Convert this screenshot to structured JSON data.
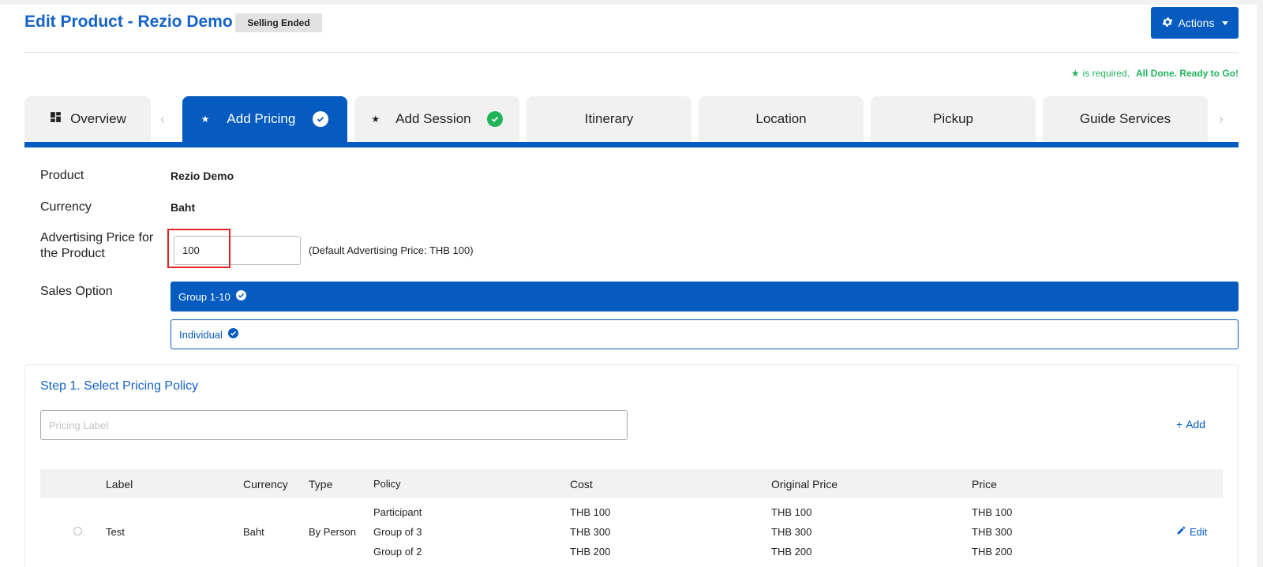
{
  "header": {
    "title": "Edit Product  - Rezio Demo",
    "status_badge": "Selling Ended",
    "actions_label": "Actions"
  },
  "required_note": {
    "star": "★",
    "text": "is required,",
    "done": "All Done. Ready to Go!"
  },
  "tabs": [
    {
      "label": "Overview",
      "icon": "dashboard-icon"
    },
    {
      "label": "Add Pricing",
      "required": true,
      "complete": true,
      "active": true
    },
    {
      "label": "Add Session",
      "required": true,
      "complete": true
    },
    {
      "label": "Itinerary"
    },
    {
      "label": "Location"
    },
    {
      "label": "Pickup"
    },
    {
      "label": "Guide Services"
    }
  ],
  "form": {
    "product_label": "Product",
    "product_value": "Rezio Demo",
    "currency_label": "Currency",
    "currency_value": "Baht",
    "adv_price_label_line1": "Advertising Price for",
    "adv_price_label_line2": "the Product",
    "adv_price_value": "100",
    "adv_price_note": "(Default Advertising Price: THB 100)",
    "sales_option_label": "Sales Option",
    "sales_options": [
      {
        "label": "Group 1-10",
        "selected": true
      },
      {
        "label": "Individual",
        "selected": false
      }
    ]
  },
  "step1": {
    "title": "Step 1. Select Pricing Policy",
    "pricing_label_placeholder": "Pricing Label",
    "add_label": "Add",
    "columns": [
      "Label",
      "Currency",
      "Type",
      "Policy",
      "Cost",
      "Original Price",
      "Price"
    ],
    "rows": [
      {
        "label": "Test",
        "currency": "Baht",
        "type": "By Person",
        "policies": [
          "Participant",
          "Group of 3",
          "Group of 2"
        ],
        "costs": [
          "THB 100",
          "THB 300",
          "THB 200"
        ],
        "original_prices": [
          "THB 100",
          "THB 300",
          "THB 200"
        ],
        "prices": [
          "THB 100",
          "THB 300",
          "THB 200"
        ],
        "edit_label": "Edit"
      }
    ]
  },
  "colors": {
    "primary": "#055bc0",
    "title": "#1463c9",
    "success": "#21b35a",
    "highlight": "#e02424"
  }
}
